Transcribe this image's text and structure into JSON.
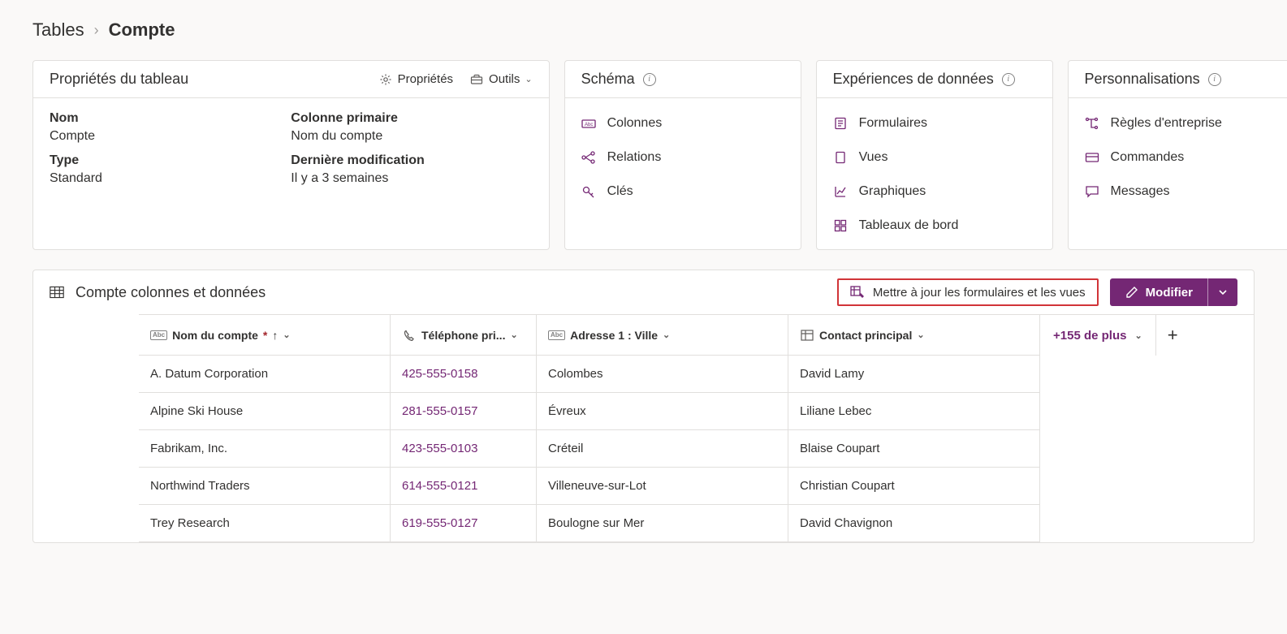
{
  "breadcrumb": {
    "parent": "Tables",
    "current": "Compte"
  },
  "cards": {
    "properties": {
      "title": "Propriétés du tableau",
      "actions": {
        "props": "Propriétés",
        "tools": "Outils"
      },
      "fields": {
        "name_label": "Nom",
        "name_value": "Compte",
        "type_label": "Type",
        "type_value": "Standard",
        "primary_label": "Colonne primaire",
        "primary_value": "Nom du compte",
        "modified_label": "Dernière modification",
        "modified_value": "Il y a 3 semaines"
      }
    },
    "schema": {
      "title": "Schéma",
      "items": [
        "Colonnes",
        "Relations",
        "Clés"
      ]
    },
    "experiences": {
      "title": "Expériences de données",
      "items": [
        "Formulaires",
        "Vues",
        "Graphiques",
        "Tableaux de bord"
      ]
    },
    "customizations": {
      "title": "Personnalisations",
      "items": [
        "Règles d'entreprise",
        "Commandes",
        "Messages"
      ]
    }
  },
  "data_section": {
    "title": "Compte colonnes et données",
    "update_label": "Mettre à jour les formulaires et les vues",
    "modify_label": "Modifier",
    "more_columns": "+155 de plus",
    "columns": {
      "name": "Nom du compte",
      "phone": "Téléphone pri...",
      "city": "Adresse 1 : Ville",
      "contact": "Contact principal"
    },
    "rows": [
      {
        "name": "A. Datum Corporation",
        "phone": "425-555-0158",
        "city": "Colombes",
        "contact": "David Lamy"
      },
      {
        "name": "Alpine Ski House",
        "phone": "281-555-0157",
        "city": "Évreux",
        "contact": "Liliane Lebec"
      },
      {
        "name": "Fabrikam, Inc.",
        "phone": "423-555-0103",
        "city": "Créteil",
        "contact": "Blaise Coupart"
      },
      {
        "name": "Northwind Traders",
        "phone": "614-555-0121",
        "city": "Villeneuve-sur-Lot",
        "contact": "Christian Coupart"
      },
      {
        "name": "Trey Research",
        "phone": "619-555-0127",
        "city": "Boulogne sur Mer",
        "contact": "David Chavignon"
      }
    ]
  }
}
